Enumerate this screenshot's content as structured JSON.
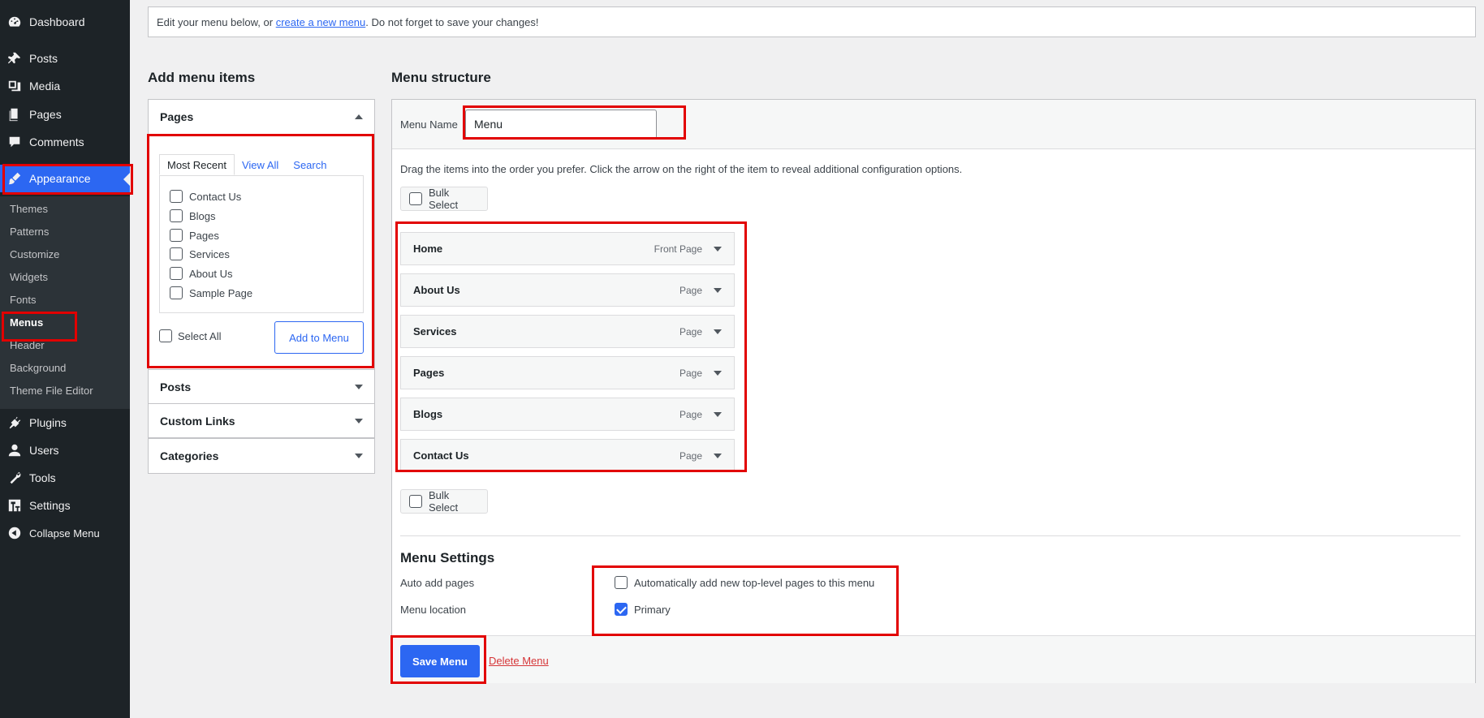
{
  "sidebar": {
    "items": [
      {
        "label": "Dashboard",
        "icon": "dashboard-icon"
      },
      {
        "label": "Posts",
        "icon": "pin-icon"
      },
      {
        "label": "Media",
        "icon": "media-icon"
      },
      {
        "label": "Pages",
        "icon": "pages-icon"
      },
      {
        "label": "Comments",
        "icon": "comment-icon"
      },
      {
        "label": "Appearance",
        "icon": "brush-icon"
      },
      {
        "label": "Plugins",
        "icon": "plugin-icon"
      },
      {
        "label": "Users",
        "icon": "user-icon"
      },
      {
        "label": "Tools",
        "icon": "wrench-icon"
      },
      {
        "label": "Settings",
        "icon": "settings-icon"
      },
      {
        "label": "Collapse Menu",
        "icon": "collapse-icon"
      }
    ],
    "submenu": [
      "Themes",
      "Patterns",
      "Customize",
      "Widgets",
      "Fonts",
      "Menus",
      "Header",
      "Background",
      "Theme File Editor"
    ]
  },
  "notice": {
    "before": "Edit your menu below, or ",
    "link": "create a new menu",
    "after": ". Do not forget to save your changes!"
  },
  "left": {
    "title": "Add menu items",
    "pages_section": "Pages",
    "tabs": [
      "Most Recent",
      "View All",
      "Search"
    ],
    "pages": [
      "Contact Us",
      "Blogs",
      "Pages",
      "Services",
      "About Us",
      "Sample Page"
    ],
    "select_all": "Select All",
    "add_to_menu": "Add to Menu",
    "sections": [
      "Posts",
      "Custom Links",
      "Categories"
    ]
  },
  "right": {
    "title": "Menu structure",
    "menu_name_label": "Menu Name",
    "menu_name_value": "Menu",
    "drag_hint": "Drag the items into the order you prefer. Click the arrow on the right of the item to reveal additional configuration options.",
    "bulk_select": "Bulk Select",
    "items": [
      {
        "title": "Home",
        "type": "Front Page"
      },
      {
        "title": "About Us",
        "type": "Page"
      },
      {
        "title": "Services",
        "type": "Page"
      },
      {
        "title": "Pages",
        "type": "Page"
      },
      {
        "title": "Blogs",
        "type": "Page"
      },
      {
        "title": "Contact Us",
        "type": "Page"
      }
    ],
    "settings": {
      "title": "Menu Settings",
      "auto_add_label": "Auto add pages",
      "auto_add_option": "Automatically add new top-level pages to this menu",
      "location_label": "Menu location",
      "location_option": "Primary",
      "location_checked": true,
      "auto_add_checked": false
    },
    "save": "Save Menu",
    "delete": "Delete Menu"
  },
  "colors": {
    "accent": "#2c67f2",
    "highlight": "#e20000",
    "sidebar": "#1d2327"
  }
}
